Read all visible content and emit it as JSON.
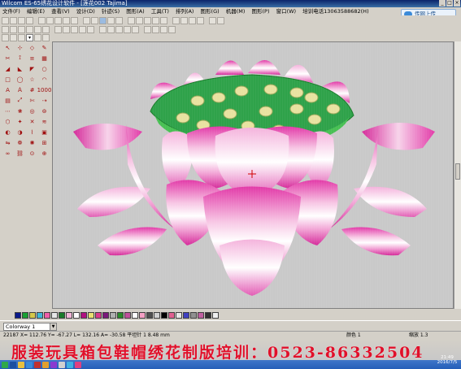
{
  "window": {
    "title": "Wilcom ES-65绣花设计软件 - [莲花002         Tajima]",
    "controls": [
      "_",
      "□",
      "×"
    ]
  },
  "menu": {
    "items": [
      "文件(F)",
      "编辑(E)",
      "查看(V)",
      "设计(D)",
      "针迹(S)",
      "图形(A)",
      "工具(T)",
      "排列(A)",
      "图形(G)",
      "机器(M)",
      "图形(P)",
      "窗口(W)",
      "培训电话13063588682(H)"
    ]
  },
  "upload_button": {
    "label": "传网上传"
  },
  "toolbar3": {
    "dropdown_value": "▾"
  },
  "colorway": {
    "selected": "Colorway 1"
  },
  "palette": {
    "colors": [
      "#0a1a8a",
      "#1aa033",
      "#d6c84a",
      "#3fb7d7",
      "#ef5ea8",
      "#e6e6e6",
      "#1a7a2a",
      "#f2b6d8",
      "#ffffff",
      "#b01080",
      "#e8e070",
      "#d83a8a",
      "#7a1a7a",
      "#b0b0b0",
      "#2a8a2a",
      "#c0509a",
      "#ffffff",
      "#f6a0c4",
      "#505050",
      "#d0d0d0",
      "#000000",
      "#e06090",
      "#e8e8e8",
      "#4040c0",
      "#909090",
      "#c060a0",
      "#303030",
      "#f0f0f0"
    ]
  },
  "status": {
    "left": "22187  X= 112.76  Y= -67.27  L= 132.16  A= -30.58  平坦针 1  8.48  mm",
    "color": "颜色 1",
    "zoom": "缩放 1.3"
  },
  "promo": {
    "text": "服装玩具箱包鞋帽绣花制版培训：0523-86332504"
  },
  "clock": {
    "time": "21:49",
    "date": "2016/7/5"
  },
  "design": {
    "description_colors": {
      "petal_magenta": "#e23aa8",
      "petal_pink": "#f2a6d6",
      "seedpod_green": "#2fa24a",
      "seed_cream": "#e8e2a0",
      "white_stitch": "#f4f4f4"
    }
  }
}
